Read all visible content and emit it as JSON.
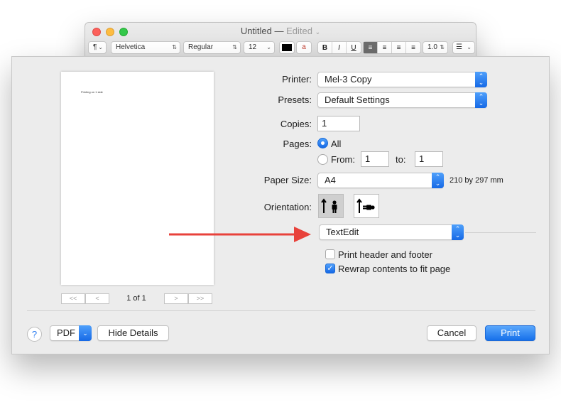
{
  "window": {
    "title": "Untitled",
    "title_sep": " — ",
    "edited": "Edited",
    "toolbar": {
      "paragraph_style": "¶",
      "font_family": "Helvetica",
      "font_style": "Regular",
      "font_size": "12",
      "bold": "B",
      "italic": "I",
      "underline": "U",
      "line_spacing": "1.0"
    }
  },
  "preview": {
    "page_text": "Printing on 1 side",
    "page_count": "1 of 1",
    "first_label": "<<",
    "prev_label": "<",
    "next_label": ">",
    "last_label": ">>"
  },
  "print": {
    "printer_label": "Printer:",
    "printer_value": "Mel-3 Copy",
    "presets_label": "Presets:",
    "presets_value": "Default Settings",
    "copies_label": "Copies:",
    "copies_value": "1",
    "pages_label": "Pages:",
    "pages_all": "All",
    "pages_from": "From:",
    "pages_from_value": "1",
    "pages_to": "to:",
    "pages_to_value": "1",
    "paper_size_label": "Paper Size:",
    "paper_size_value": "A4",
    "paper_size_dims": "210 by 297 mm",
    "orientation_label": "Orientation:",
    "section_value": "TextEdit",
    "header_footer": "Print header and footer",
    "rewrap": "Rewrap contents to fit page"
  },
  "footer": {
    "help": "?",
    "pdf": "PDF",
    "hide_details": "Hide Details",
    "cancel": "Cancel",
    "print": "Print"
  },
  "colors": {
    "accent": "#1a6ff0",
    "annotation_arrow": "#e8423b"
  }
}
